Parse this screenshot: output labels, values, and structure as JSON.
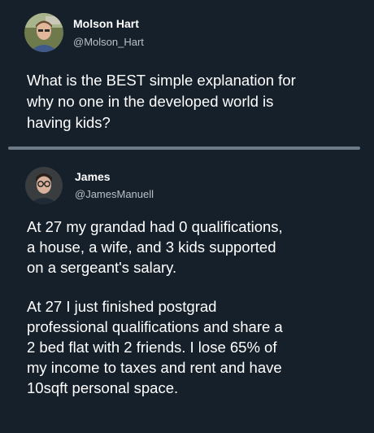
{
  "post_1": {
    "author": {
      "display_name": "Molson Hart",
      "handle": "@Molson_Hart",
      "avatar": "person-avatar-outdoor"
    },
    "text_lines": [
      "What is the BEST simple explanation for",
      "why no one in the developed world is",
      "having kids?"
    ]
  },
  "post_2": {
    "author": {
      "display_name": "James",
      "handle": "@JamesManuell",
      "avatar": "person-avatar-glasses"
    },
    "paragraph_1": [
      "At 27 my grandad had 0 qualifications,",
      "a house, a wife, and 3 kids supported",
      "on a sergeant's salary."
    ],
    "paragraph_2": [
      "At 27 I just finished postgrad",
      "professional qualifications and share a",
      "2 bed flat with 2 friends. I lose 65% of",
      "my income to taxes and rent and have",
      "10sqft personal space."
    ]
  },
  "colors": {
    "background": "#15202b",
    "divider": "#6b7a86",
    "handle": "#b9c0c6"
  }
}
